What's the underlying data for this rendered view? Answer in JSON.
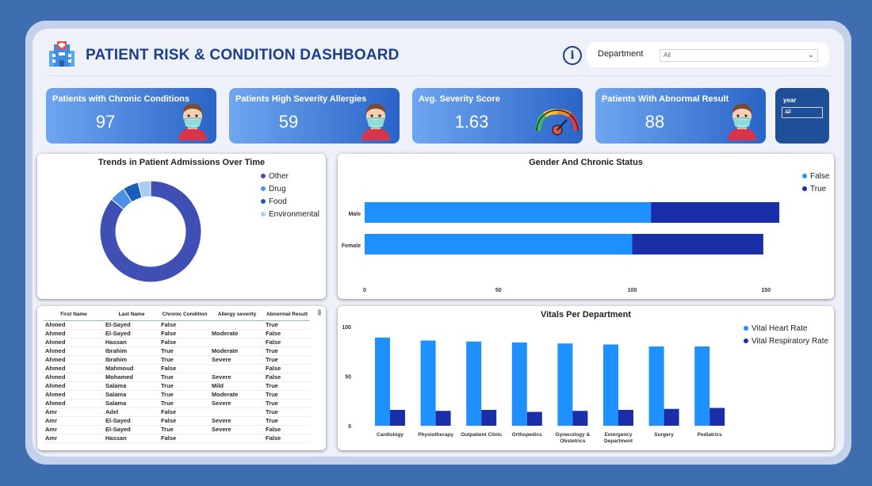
{
  "header": {
    "title": "PATIENT RISK & CONDITION DASHBOARD",
    "info_icon": "info-icon",
    "department_label": "Department",
    "department_value": "All"
  },
  "kpis": [
    {
      "title": "Patients with Chronic Conditions",
      "value": "97",
      "icon": "masked-patient-icon"
    },
    {
      "title": "Patients High Severity Allergies",
      "value": "59",
      "icon": "masked-patient-icon"
    },
    {
      "title": "Avg. Severity Score",
      "value": "1.63",
      "icon": "gauge-icon"
    },
    {
      "title": "Patients With Abnormal Result",
      "value": "88",
      "icon": "masked-patient-icon"
    }
  ],
  "year_filter": {
    "label": "year",
    "value": "All"
  },
  "colors": {
    "primary_blue": "#1e90ff",
    "dark_blue": "#1a2ea8",
    "donut_main": "#3f4fb3",
    "title_blue": "#1c3f8c"
  },
  "chart_data": [
    {
      "type": "pie",
      "donut": true,
      "title": "Trends in Patient Admissions Over Time",
      "categories": [
        "Other",
        "Drug",
        "Food",
        "Environmental"
      ],
      "values": [
        86,
        5,
        5,
        4
      ],
      "colors": [
        "#3f4fb3",
        "#4a90e8",
        "#1a5cba",
        "#a9cdf2"
      ],
      "legend": "right"
    },
    {
      "type": "bar",
      "orientation": "horizontal",
      "stacked": true,
      "title": "Gender And Chronic Status",
      "categories": [
        "Male",
        "Female"
      ],
      "series": [
        {
          "name": "False",
          "values": [
            107,
            100
          ],
          "color": "#1e90ff"
        },
        {
          "name": "True",
          "values": [
            48,
            49
          ],
          "color": "#1a2ea8"
        }
      ],
      "xticks": [
        "0",
        "50",
        "100",
        "150"
      ],
      "xlim": [
        0,
        160
      ],
      "legend": "top-right"
    },
    {
      "type": "bar",
      "title": "Vitals Per Department",
      "categories": [
        "Cardiology",
        "Physiotherapy",
        "Outpatient Clinic",
        "Orthopedics",
        "Gynecology & Obstetrics",
        "Emergency Department",
        "Surgery",
        "Pediatrics"
      ],
      "series": [
        {
          "name": "Vital Heart Rate",
          "values": [
            89,
            86,
            85,
            84,
            83,
            82,
            80,
            80
          ],
          "color": "#1e90ff"
        },
        {
          "name": "Vital Respiratory Rate",
          "values": [
            16,
            15,
            16,
            14,
            15,
            16,
            17,
            18
          ],
          "color": "#1a2ea8"
        }
      ],
      "yticks": [
        "100",
        "50",
        "0"
      ],
      "ylim": [
        0,
        100
      ],
      "legend": "top-right"
    }
  ],
  "table": {
    "columns": [
      "First Name",
      "Last Name",
      "Chronic Condition",
      "Allergy severity",
      "Abnormal Result"
    ],
    "rows": [
      [
        "Ahmed",
        "El-Sayed",
        "False",
        "",
        "True"
      ],
      [
        "Ahmed",
        "El-Sayed",
        "False",
        "Moderate",
        "False"
      ],
      [
        "Ahmed",
        "Hassan",
        "False",
        "",
        "False"
      ],
      [
        "Ahmed",
        "Ibrahim",
        "True",
        "Moderate",
        "True"
      ],
      [
        "Ahmed",
        "Ibrahim",
        "True",
        "Severe",
        "True"
      ],
      [
        "Ahmed",
        "Mahmoud",
        "False",
        "",
        "False"
      ],
      [
        "Ahmed",
        "Mohamed",
        "True",
        "Severe",
        "False"
      ],
      [
        "Ahmed",
        "Salama",
        "True",
        "Mild",
        "True"
      ],
      [
        "Ahmed",
        "Salama",
        "True",
        "Moderate",
        "True"
      ],
      [
        "Ahmed",
        "Salama",
        "True",
        "Severe",
        "True"
      ],
      [
        "Amr",
        "Adel",
        "False",
        "",
        "True"
      ],
      [
        "Amr",
        "El-Sayed",
        "False",
        "Severe",
        "True"
      ],
      [
        "Amr",
        "El-Sayed",
        "True",
        "Severe",
        "False"
      ],
      [
        "Amr",
        "Hassan",
        "False",
        "",
        "False"
      ]
    ]
  }
}
